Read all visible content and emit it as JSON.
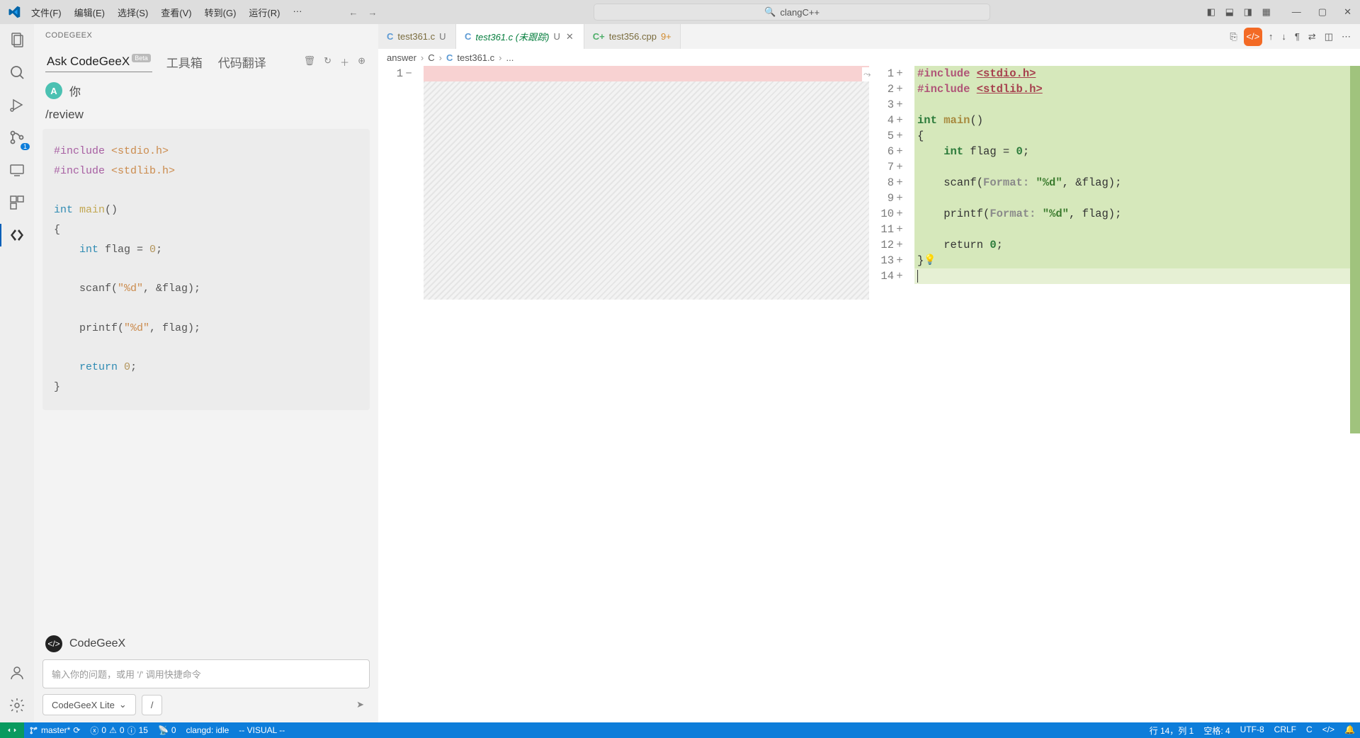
{
  "menu": {
    "file": "文件(F)",
    "edit": "编辑(E)",
    "select": "选择(S)",
    "view": "查看(V)",
    "goto": "转到(G)",
    "run": "运行(R)"
  },
  "command_center": "clangC++",
  "activity": {
    "scm_badge": "1"
  },
  "sidebar": {
    "title": "CODEGEEX",
    "tabs": {
      "ask": "Ask CodeGeeX",
      "beta": "Beta",
      "toolbox": "工具箱",
      "translate": "代码翻译"
    },
    "user_name": "你",
    "command": "/review",
    "code": {
      "l1a": "#include",
      "l1b": "<stdio.h>",
      "l2a": "#include",
      "l2b": "<stdlib.h>",
      "l3a": "int",
      "l3b": "main",
      "l3c": "()",
      "l4": "{",
      "l5a": "int",
      "l5b": " flag = ",
      "l5c": "0",
      "l5d": ";",
      "l6a": "    scanf(",
      "l6b": "\"%d\"",
      "l6c": ", &flag);",
      "l7a": "    printf(",
      "l7b": "\"%d\"",
      "l7c": ", flag);",
      "l8a": "return",
      "l8b": "0",
      "l8c": ";",
      "l9": "}"
    },
    "ai_name": "CodeGeeX",
    "input_placeholder": "输入你的问题，或用 '/' 调用快捷命令",
    "model": "CodeGeeX Lite",
    "slash": "/"
  },
  "tabs": {
    "t1": {
      "name": "test361.c",
      "mod": "U"
    },
    "t2": {
      "name": "test361.c",
      "suffix": "(未跟踪)",
      "mod": "U"
    },
    "t3": {
      "name": "test356.cpp",
      "badge": "9+"
    }
  },
  "crumbs": {
    "c1": "answer",
    "c2": "C",
    "c3": "test361.c",
    "c4": "..."
  },
  "diff_right": {
    "l1a": "#include ",
    "l1b": "<stdio.h>",
    "l2a": "#include ",
    "l2b": "<stdlib.h>",
    "l4a": "int ",
    "l4b": "main",
    "l4c": "()",
    "l5": "{",
    "l6a": "    int ",
    "l6b": "flag = ",
    "l6c": "0",
    "l6d": ";",
    "l8a": "    scanf(",
    "l8b": "Format: ",
    "l8c": "\"%d\"",
    "l8d": ", &flag);",
    "l10a": "    printf(",
    "l10b": "Format: ",
    "l10c": "\"%d\"",
    "l10d": ", flag);",
    "l12a": "    return ",
    "l12b": "0",
    "l12c": ";",
    "l13": "}"
  },
  "line_numbers_left": {
    "1": "1"
  },
  "line_numbers_right": {
    "1": "1",
    "2": "2",
    "3": "3",
    "4": "4",
    "5": "5",
    "6": "6",
    "7": "7",
    "8": "8",
    "9": "9",
    "10": "10",
    "11": "11",
    "12": "12",
    "13": "13",
    "14": "14"
  },
  "status": {
    "branch": "master*",
    "errors": "0",
    "warnings": "0",
    "info": "15",
    "ports": "0",
    "clangd": "clangd: idle",
    "mode": "-- VISUAL --",
    "pos": "行 14，列 1",
    "spaces": "空格: 4",
    "encoding": "UTF-8",
    "eol": "CRLF",
    "lang": "C"
  }
}
